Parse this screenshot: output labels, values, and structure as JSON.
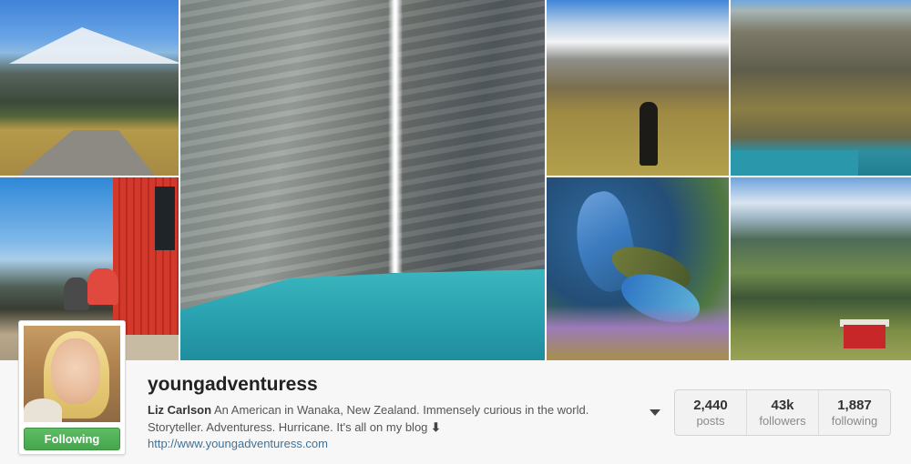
{
  "profile": {
    "username": "youngadventuress",
    "full_name": "Liz Carlson",
    "bio_text": " An American in Wanaka, New Zealand. Immensely curious in the world. Storyteller. Adventuress. Hurricane. It's all on my blog ",
    "bio_arrow": "⬇",
    "website": "http://www.youngadventuress.com",
    "follow_button_label": "Following"
  },
  "stats": [
    {
      "value": "2,440",
      "label": "posts"
    },
    {
      "value": "43k",
      "label": "followers"
    },
    {
      "value": "1,887",
      "label": "following"
    }
  ],
  "colors": {
    "follow_green": "#4cae52",
    "link_blue": "#3f729b",
    "text_dark": "#222222"
  },
  "icons": {
    "options_menu": "chevron-down-icon"
  }
}
